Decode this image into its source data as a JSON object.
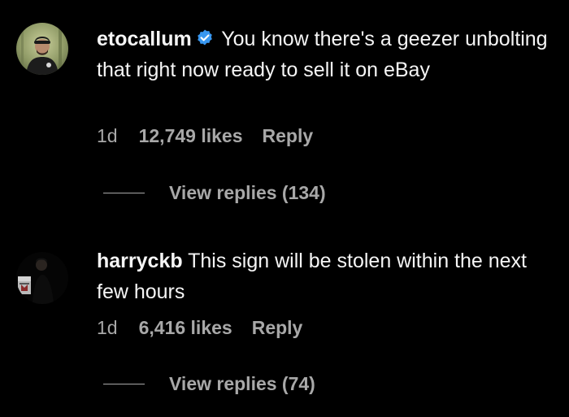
{
  "comments": [
    {
      "username": "etocallum",
      "verified": true,
      "text": "You know there's a geezer unbolting that right now ready to sell it on eBay",
      "time": "1d",
      "likes": "12,749 likes",
      "reply_label": "Reply",
      "view_replies": "View replies (134)",
      "avatar_icon": "person-avatar"
    },
    {
      "username": "harryckb",
      "verified": false,
      "text": "This sign will be stolen within the next few hours",
      "time": "1d",
      "likes": "6,416 likes",
      "reply_label": "Reply",
      "view_replies": "View replies (74)",
      "avatar_icon": "person-avatar"
    }
  ],
  "colors": {
    "background": "#000000",
    "primary_text": "#f5f5f5",
    "secondary_text": "#a8a8a8",
    "verified_badge": "#3897f0"
  }
}
